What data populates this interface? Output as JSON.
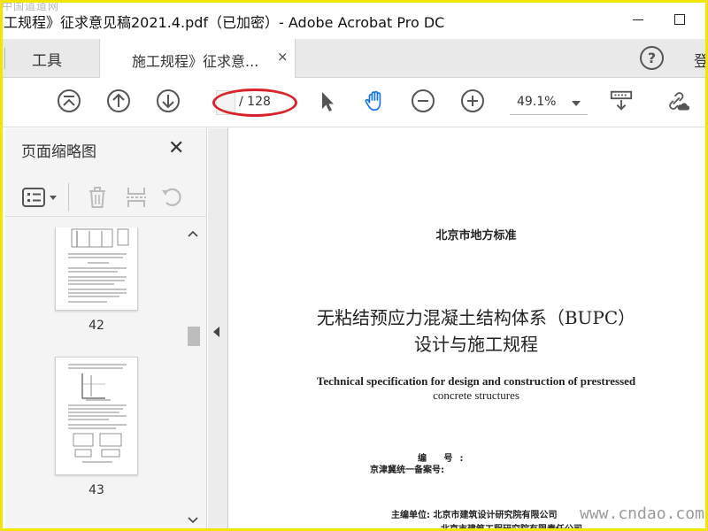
{
  "window": {
    "title": "工规程》征求意见稿2021.4.pdf（已加密）- Adobe Acrobat Pro DC",
    "watermark_top": "中国道道网"
  },
  "tabs": {
    "tools_label": "工具",
    "doc_tab_label": "施工规程》征求意...",
    "doc_tab_close": "×",
    "help": "?",
    "login": "登"
  },
  "toolbar": {
    "page_current": "",
    "page_total": "/ 128",
    "zoom": "49.1%"
  },
  "thumbnails_panel": {
    "title": "页面缩略图",
    "close": "✕",
    "pages": [
      {
        "label": "42"
      },
      {
        "label": "43"
      }
    ]
  },
  "document": {
    "standard_type": "北京市地方标准",
    "title_line1": "无粘结预应力混凝土结构体系（BUPC）",
    "title_line2": "设计与施工规程",
    "english_line1": "Technical specification for design and construction of prestressed",
    "english_line2": "concrete structures",
    "code_label": "编 号:",
    "record_label": "京津冀统一备案号:",
    "editor_line1": "主编单位: 北京市建筑设计研究院有限公司",
    "editor_line2": "北京市建筑工程研究院有限责任公司"
  },
  "watermark_bottom": "www.cndao.com",
  "colors": {
    "accent_blue": "#1473e6",
    "annotation_red": "#d9232a",
    "frame_yellow": "#f2e600"
  }
}
